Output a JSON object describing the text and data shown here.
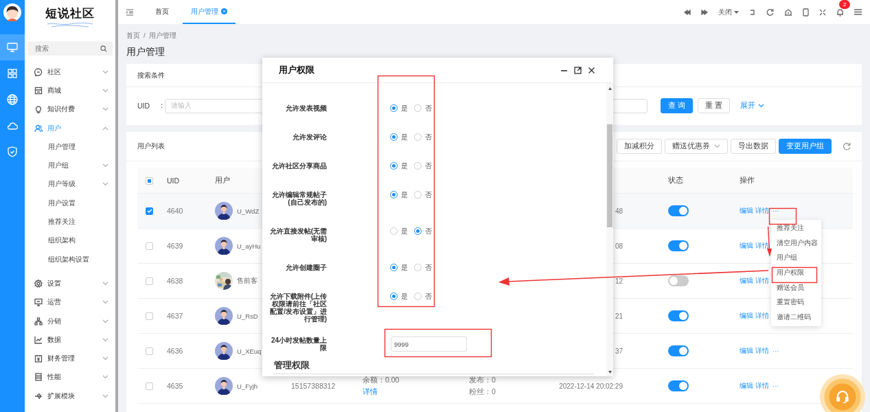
{
  "rail": [
    {
      "selected": true
    },
    {
      "selected": false
    },
    {
      "selected": false
    },
    {
      "selected": false
    },
    {
      "selected": false
    }
  ],
  "logo": {
    "title": "短说社区"
  },
  "sidebar": {
    "search_placeholder": "搜索",
    "items": [
      {
        "label": "社区",
        "expanded": false
      },
      {
        "label": "商城",
        "expanded": false
      },
      {
        "label": "知识付费",
        "expanded": false
      },
      {
        "label": "用户",
        "expanded": true,
        "children": [
          {
            "label": "用户管理",
            "kind": "link"
          },
          {
            "label": "用户组",
            "kind": "group"
          },
          {
            "label": "用户等级",
            "kind": "group"
          },
          {
            "label": "用户设置",
            "kind": "link"
          },
          {
            "label": "推荐关注",
            "kind": "link"
          },
          {
            "label": "组织架构",
            "kind": "link"
          },
          {
            "label": "组织架构设置",
            "kind": "link"
          }
        ]
      },
      {
        "label": "设置",
        "expanded": false
      },
      {
        "label": "运营",
        "expanded": false
      },
      {
        "label": "分销",
        "expanded": false
      },
      {
        "label": "数据",
        "expanded": false
      },
      {
        "label": "财务管理",
        "expanded": false
      },
      {
        "label": "性能",
        "expanded": false
      },
      {
        "label": "扩展模块",
        "expanded": false
      }
    ]
  },
  "topbar": {
    "tabs": [
      {
        "label": "首页",
        "selected": false,
        "closable": false
      },
      {
        "label": "用户管理",
        "selected": true,
        "closable": true
      }
    ],
    "close_menu": "关闭",
    "notifications": "2"
  },
  "breadcrumb": {
    "items": [
      "首页",
      "用户管理"
    ],
    "separator": "/"
  },
  "page_title": "用户管理",
  "search": {
    "title": "搜索条件",
    "field_label": "UID",
    "colon": "：",
    "placeholder": "请输入",
    "buttons": [
      {
        "label": "查 询",
        "kind": "primary"
      },
      {
        "label": "重 置",
        "kind": "default"
      }
    ],
    "expand": "展开"
  },
  "user_list": {
    "title": "用户列表",
    "actions": [
      {
        "label": "加减积分",
        "kind": "default"
      },
      {
        "label": "赠送优惠券",
        "kind": "dropdown"
      },
      {
        "label": "导出数据",
        "kind": "default"
      },
      {
        "label": "变更用户组",
        "kind": "primary"
      }
    ],
    "select_all": {
      "indeterminate": true
    },
    "columns": {
      "uid": "UID",
      "user": "用户",
      "status": "状态",
      "actions": "操作"
    },
    "rows": [
      {
        "uid": "4640",
        "user": "U_WdZ",
        "kind": "figure",
        "time": "48",
        "checked": true,
        "on": true,
        "links": [
          "编辑",
          "详情",
          "···"
        ]
      },
      {
        "uid": "4639",
        "user": "U_ayHu",
        "kind": "figure",
        "time": "08",
        "checked": false,
        "on": true,
        "links": [
          "编辑",
          "详情"
        ]
      },
      {
        "uid": "4638",
        "user": "售前客",
        "kind": "picture",
        "time": "12",
        "checked": false,
        "on": false,
        "links": [
          "编辑",
          "详情"
        ]
      },
      {
        "uid": "4637",
        "user": "U_RsD",
        "kind": "figure",
        "time": "21",
        "checked": false,
        "on": true,
        "links": [
          "编辑",
          "详情"
        ]
      },
      {
        "uid": "4636",
        "user": "U_XEuq",
        "kind": "figure",
        "time": "37",
        "checked": false,
        "on": true,
        "links": [
          "编辑",
          "详情",
          "···"
        ]
      },
      {
        "uid": "4635",
        "user": "U_Fyjh",
        "kind": "figure",
        "phone": "15157388312",
        "balance": "余额：0.00",
        "balance_link": "详情",
        "posts": "发布：0",
        "fans": "粉丝：0",
        "time": "2022-12-14 20:02:29",
        "checked": false,
        "on": true,
        "links": [
          "编辑",
          "详情",
          "···"
        ]
      }
    ]
  },
  "modal": {
    "title": "用户权限",
    "permissions": [
      {
        "label": "允许发表视频",
        "choices": [
          {
            "label": "是",
            "selected": true
          },
          {
            "label": "否",
            "selected": false
          }
        ]
      },
      {
        "label": "允许发评论",
        "choices": [
          {
            "label": "是",
            "selected": true
          },
          {
            "label": "否",
            "selected": false
          }
        ]
      },
      {
        "label": "允许社区分享商品",
        "choices": [
          {
            "label": "是",
            "selected": true
          },
          {
            "label": "否",
            "selected": false
          }
        ]
      },
      {
        "label": "允许编辑常规帖子(自己发布的)",
        "choices": [
          {
            "label": "是",
            "selected": true
          },
          {
            "label": "否",
            "selected": false
          }
        ]
      },
      {
        "label": "允许直接发帖(无需审核)",
        "choices": [
          {
            "label": "是",
            "selected": false
          },
          {
            "label": "否",
            "selected": true
          }
        ]
      },
      {
        "label": "允许创建圈子",
        "choices": [
          {
            "label": "是",
            "selected": true
          },
          {
            "label": "否",
            "selected": false
          }
        ]
      },
      {
        "label": "允许下载附件(上传权限请前往「社区配置/发布设置」进行管理)",
        "choices": [
          {
            "label": "是",
            "selected": true
          },
          {
            "label": "否",
            "selected": false
          }
        ]
      }
    ],
    "limit": {
      "label": "24小时发帖数量上限",
      "value": "9999"
    },
    "section": "管理权限"
  },
  "row_menu": {
    "items": [
      "推荐关注",
      "清空用户内容",
      "用户组",
      "用户权限",
      "赠送会员",
      "重置密码",
      "邀请二维码"
    ]
  }
}
